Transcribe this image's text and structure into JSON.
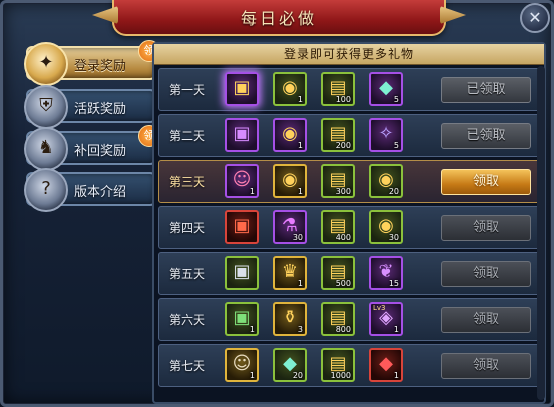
{
  "window": {
    "title": "每日必做",
    "close": "✕"
  },
  "sidebar": {
    "tabs": [
      {
        "label": "登录奖励",
        "icon": "wings-icon",
        "badge": "领",
        "active": true
      },
      {
        "label": "活跃奖励",
        "icon": "shield-icon",
        "badge": "",
        "active": false
      },
      {
        "label": "补回奖励",
        "icon": "rider-icon",
        "badge": "领",
        "active": false
      },
      {
        "label": "版本介绍",
        "icon": "question-icon",
        "badge": "",
        "active": false
      }
    ]
  },
  "panel": {
    "banner": "登录即可获得更多礼物",
    "rows": [
      {
        "day": "第一天",
        "items": [
          {
            "icon": "silver-chest-icon",
            "qty": "",
            "rarity": "purple",
            "glow": true
          },
          {
            "icon": "gold-coins-icon",
            "qty": "1",
            "rarity": "green"
          },
          {
            "icon": "gold-ticket-icon",
            "qty": "100",
            "rarity": "green"
          },
          {
            "icon": "gem-icon",
            "qty": "5",
            "rarity": "purple"
          }
        ],
        "button": "已领取",
        "state": "claimed"
      },
      {
        "day": "第二天",
        "items": [
          {
            "icon": "purple-chest-icon",
            "qty": "",
            "rarity": "purple"
          },
          {
            "icon": "gold-coins-icon",
            "qty": "1",
            "rarity": "purple"
          },
          {
            "icon": "gold-ticket-icon",
            "qty": "200",
            "rarity": "green"
          },
          {
            "icon": "feather-icon",
            "qty": "5",
            "rarity": "purple"
          }
        ],
        "button": "已领取",
        "state": "claimed"
      },
      {
        "day": "第三天",
        "items": [
          {
            "icon": "portrait-icon",
            "qty": "1",
            "rarity": "purple"
          },
          {
            "icon": "gold-coins-icon",
            "qty": "1",
            "rarity": "gold"
          },
          {
            "icon": "gold-ticket-icon",
            "qty": "300",
            "rarity": "green"
          },
          {
            "icon": "gold-coins-icon",
            "qty": "20",
            "rarity": "green"
          }
        ],
        "button": "领取",
        "state": "claim"
      },
      {
        "day": "第四天",
        "items": [
          {
            "icon": "red-chest-icon",
            "qty": "",
            "rarity": "red"
          },
          {
            "icon": "potion-icon",
            "qty": "30",
            "rarity": "purple"
          },
          {
            "icon": "gold-ticket-icon",
            "qty": "400",
            "rarity": "green"
          },
          {
            "icon": "gold-coins-icon",
            "qty": "30",
            "rarity": "green"
          }
        ],
        "button": "领取",
        "state": "locked"
      },
      {
        "day": "第五天",
        "items": [
          {
            "icon": "silver-chest-icon",
            "qty": "",
            "rarity": "green"
          },
          {
            "icon": "crown-icon",
            "qty": "1",
            "rarity": "gold"
          },
          {
            "icon": "gold-ticket-icon",
            "qty": "500",
            "rarity": "green"
          },
          {
            "icon": "purple-feather-icon",
            "qty": "15",
            "rarity": "purple"
          }
        ],
        "button": "领取",
        "state": "locked"
      },
      {
        "day": "第六天",
        "items": [
          {
            "icon": "green-chest-icon",
            "qty": "1",
            "rarity": "green"
          },
          {
            "icon": "bottle-icon",
            "qty": "3",
            "rarity": "gold"
          },
          {
            "icon": "gold-ticket-icon",
            "qty": "800",
            "rarity": "green"
          },
          {
            "icon": "lv3-item-icon",
            "qty": "1",
            "rarity": "purple",
            "extra": "Lv3"
          }
        ],
        "button": "领取",
        "state": "locked"
      },
      {
        "day": "第七天",
        "items": [
          {
            "icon": "lion-portrait-icon",
            "qty": "1",
            "rarity": "gold"
          },
          {
            "icon": "gem-icon",
            "qty": "20",
            "rarity": "green"
          },
          {
            "icon": "gold-ticket-icon",
            "qty": "1000",
            "rarity": "green"
          },
          {
            "icon": "red-crystal-icon",
            "qty": "1",
            "rarity": "red"
          }
        ],
        "button": "领取",
        "state": "locked"
      }
    ]
  },
  "colors": {
    "title_red": "#8f1718",
    "claim_gold": "#c67a16",
    "border_gold": "#e8b86a"
  }
}
